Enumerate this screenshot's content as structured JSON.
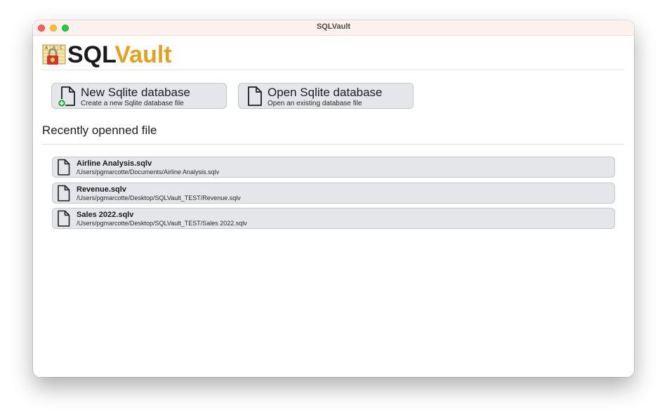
{
  "window": {
    "title": "SQLVault"
  },
  "logo": {
    "sql": "SQL",
    "vault": "Vault",
    "icon": "abc-lock-icon",
    "icon_letters": [
      "A",
      "B",
      "C"
    ]
  },
  "actions": {
    "new_db": {
      "title": "New Sqlite database",
      "subtitle": "Create a new Sqlite database file",
      "icon": "new-file-plus-icon"
    },
    "open_db": {
      "title": "Open Sqlite database",
      "subtitle": "Open an existing database file",
      "icon": "file-icon"
    }
  },
  "recent": {
    "heading": "Recently openned file",
    "files": [
      {
        "name": "Airline Analysis.sqlv",
        "path": "/Users/pgmarcotte/Documents/Airline Analysis.sqlv"
      },
      {
        "name": "Revenue.sqlv",
        "path": "/Users/pgmarcotte/Desktop/SQLVault_TEST/Revenue.sqlv"
      },
      {
        "name": "Sales 2022.sqlv",
        "path": "/Users/pgmarcotte/Desktop/SQLVault_TEST/Sales 2022.sqlv"
      }
    ]
  },
  "colors": {
    "accent": "#e6a021",
    "button_bg": "#e4e6e9",
    "titlebar_bg": "#fdf1ee",
    "close": "#fe5f57",
    "minimize": "#febc2e",
    "zoom": "#28c840",
    "plus_badge": "#2bb24c"
  }
}
